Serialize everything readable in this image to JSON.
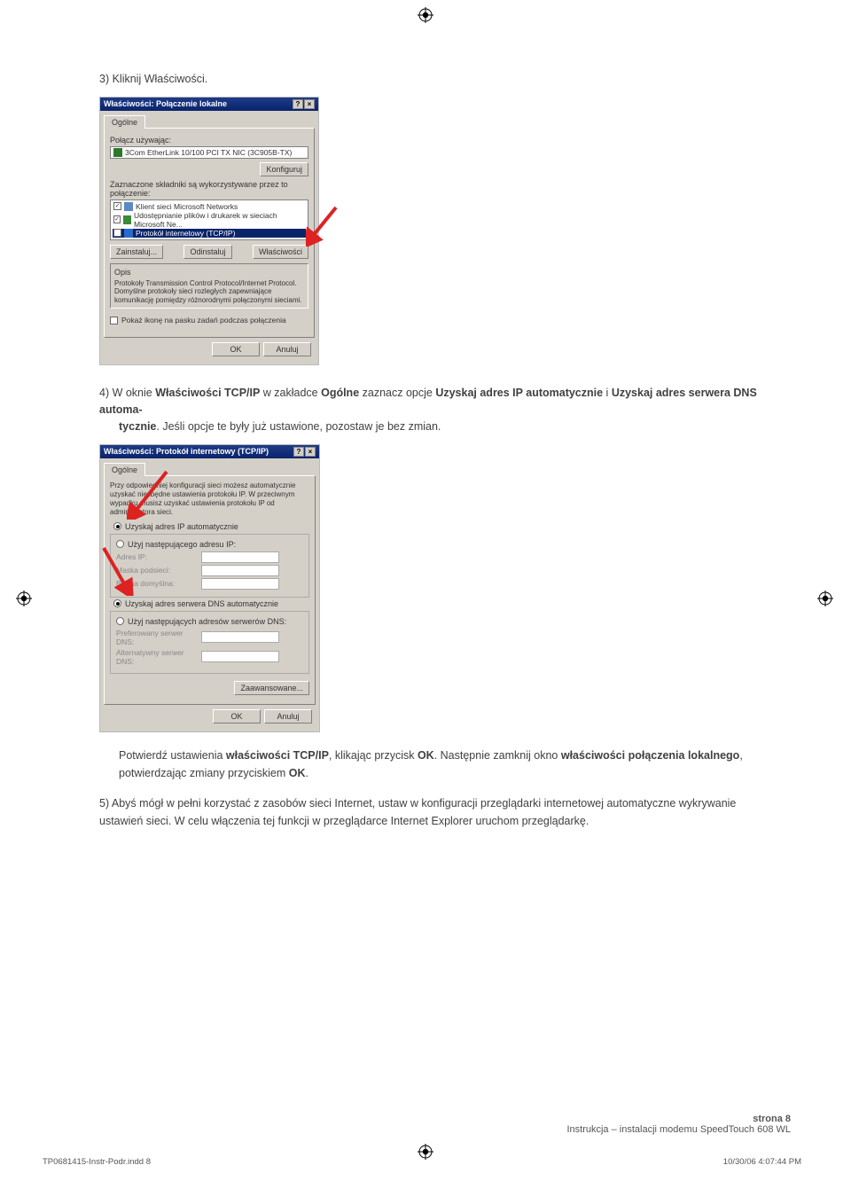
{
  "cropmark": "registration-mark",
  "step3": "3) Kliknij Właściwości.",
  "dialog1": {
    "title": "Właściwości: Połączenie lokalne",
    "help": "?",
    "close": "×",
    "tab": "Ogólne",
    "connect_using": "Połącz używając:",
    "adapter": "3Com EtherLink 10/100 PCI TX NIC (3C905B-TX)",
    "configure": "Konfiguruj",
    "components_label": "Zaznaczone składniki są wykorzystywane przez to połączenie:",
    "item1": "Klient sieci Microsoft Networks",
    "item2": "Udostępnianie plików i drukarek w sieciach Microsoft Ne...",
    "item3": "Protokół internetowy (TCP/IP)",
    "install": "Zainstaluj...",
    "uninstall": "Odinstaluj",
    "properties": "Właściwości",
    "desc_title": "Opis",
    "desc": "Protokoły Transmission Control Protocol/Internet Protocol. Domyślne protokoły sieci rozległych zapewniające komunikację pomiędzy różnorodnymi połączonymi sieciami.",
    "show_icon": "Pokaż ikonę na pasku zadań podczas połączenia",
    "ok": "OK",
    "cancel": "Anuluj"
  },
  "step4_a": "4) W oknie ",
  "step4_b": "Właściwości TCP/IP",
  "step4_c": " w zakładce ",
  "step4_d": "Ogólne",
  "step4_e": " zaznacz opcje ",
  "step4_f": "Uzyskaj adres IP automatycznie",
  "step4_g": " i ",
  "step4_h": "Uzyskaj adres serwera DNS automa-",
  "step4_i": "tycznie",
  "step4_j": ". Jeśli opcje te były już ustawione, pozostaw je bez zmian.",
  "dialog2": {
    "title": "Właściwości: Protokół internetowy (TCP/IP)",
    "help": "?",
    "close": "×",
    "tab": "Ogólne",
    "intro": "Przy odpowiedniej konfiguracji sieci możesz automatycznie uzyskać niezbędne ustawienia protokołu IP. W przeciwnym wypadku musisz uzyskać ustawienia protokołu IP od administratora sieci.",
    "radio_ip_auto": "Uzyskaj adres IP automatycznie",
    "radio_ip_manual": "Użyj następującego adresu IP:",
    "ip_label": "Adres IP:",
    "mask_label": "Maska podsieci:",
    "gateway_label": "Brama domyślna:",
    "radio_dns_auto": "Uzyskaj adres serwera DNS automatycznie",
    "radio_dns_manual": "Użyj następujących adresów serwerów DNS:",
    "pref_dns": "Preferowany serwer DNS:",
    "alt_dns": "Alternatywny serwer DNS:",
    "advanced": "Zaawansowane...",
    "ok": "OK",
    "cancel": "Anuluj"
  },
  "confirm_a": "Potwierdź ustawienia ",
  "confirm_b": "właściwości TCP/IP",
  "confirm_c": ", klikając przycisk ",
  "confirm_d": "OK",
  "confirm_e": ". Następnie zamknij okno ",
  "confirm_f": "właściwości połączenia lokalnego",
  "confirm_g": ", potwierdzając zmiany przyciskiem ",
  "confirm_h": "OK",
  "confirm_i": ".",
  "step5_a": "5) Abyś mógł w pełni korzystać z zasobów sieci Internet, ustaw w konfiguracji przeglądarki internetowej automatyczne wykrywanie ustawień sieci. W celu włączenia tej funkcji w przeglądarce Internet Explorer uruchom przeglądarkę.",
  "footer_page": "strona 8",
  "footer_title": "Instrukcja – instalacji modemu SpeedTouch 608 WL",
  "print_left": "TP0681415-Instr-Podr.indd   8",
  "print_right": "10/30/06   4:07:44 PM"
}
